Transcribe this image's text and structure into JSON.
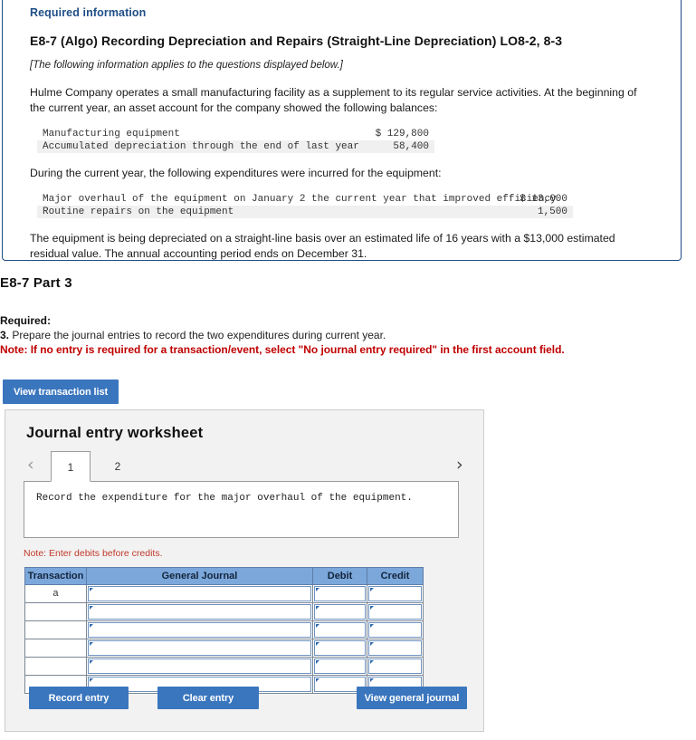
{
  "info_box": {
    "required_information_label": "Required information",
    "problem_title": "E8-7 (Algo) Recording Depreciation and Repairs (Straight-Line Depreciation) LO8-2, 8-3",
    "applies_note": "[The following information applies to the questions displayed below.]",
    "paragraph_1": "Hulme Company operates a small manufacturing facility as a supplement to its regular service activities. At the beginning of the current year, an asset account for the company showed the following balances:",
    "balances_table": [
      {
        "label": "Manufacturing equipment",
        "value": "$ 129,800"
      },
      {
        "label": "Accumulated depreciation through the end of last year",
        "value": "58,400"
      }
    ],
    "paragraph_2": "During the current year, the following expenditures were incurred for the equipment:",
    "expenditures_table": [
      {
        "label": "Major overhaul of the equipment on January 2 the current year that improved efficiency",
        "value": "$ 13,000"
      },
      {
        "label": "Routine repairs on the equipment",
        "value": "1,500"
      }
    ],
    "paragraph_3": "The equipment is being depreciated on a straight-line basis over an estimated life of 16 years with a $13,000 estimated residual value. The annual accounting period ends on December 31."
  },
  "part": {
    "heading": "E8-7 Part 3",
    "required_label": "Required:",
    "item_number": "3.",
    "item_text": " Prepare the journal entries to record the two expenditures during current year.",
    "note": "Note: If no entry is required for a transaction/event, select \"No journal entry required\" in the first account field."
  },
  "buttons": {
    "view_transaction_list": "View transaction list",
    "record_entry": "Record entry",
    "clear_entry": "Clear entry",
    "view_general_journal": "View general journal"
  },
  "worksheet": {
    "title": "Journal entry worksheet",
    "prev_icon": "‹",
    "next_icon": "›",
    "tabs": [
      {
        "label": "1",
        "active": true
      },
      {
        "label": "2",
        "active": false
      }
    ],
    "description": "Record the expenditure for the major overhaul of the equipment.",
    "note_debits": "Note: Enter debits before credits.",
    "table": {
      "headers": [
        "Transaction",
        "General Journal",
        "Debit",
        "Credit"
      ],
      "rows": [
        {
          "transaction": "a",
          "general_journal": "",
          "debit": "",
          "credit": ""
        },
        {
          "transaction": "",
          "general_journal": "",
          "debit": "",
          "credit": ""
        },
        {
          "transaction": "",
          "general_journal": "",
          "debit": "",
          "credit": ""
        },
        {
          "transaction": "",
          "general_journal": "",
          "debit": "",
          "credit": ""
        },
        {
          "transaction": "",
          "general_journal": "",
          "debit": "",
          "credit": ""
        },
        {
          "transaction": "",
          "general_journal": "",
          "debit": "",
          "credit": ""
        }
      ]
    }
  },
  "colors": {
    "accent_blue": "#3A76BE",
    "header_blue": "#7BA7DB",
    "border_blue": "#1F4E87",
    "note_red": "#C00000",
    "panel_gray": "#f2f2f2"
  }
}
